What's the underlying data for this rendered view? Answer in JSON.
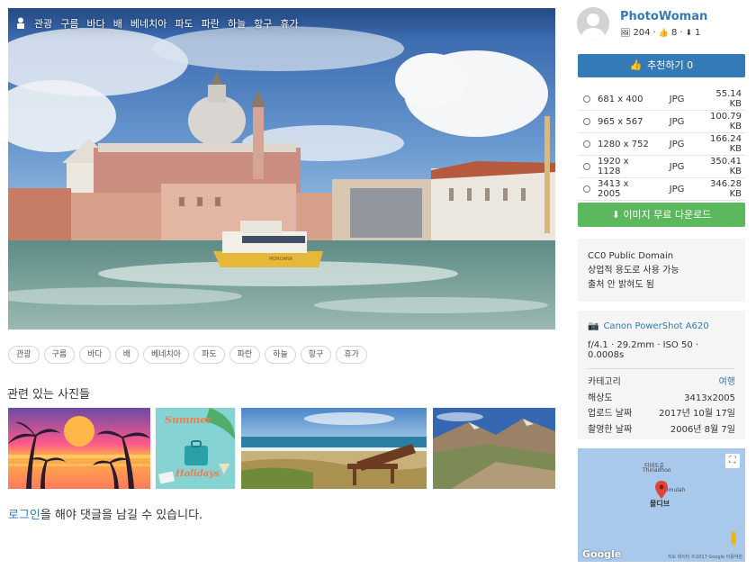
{
  "photo": {
    "tags": [
      "관광",
      "구름",
      "바다",
      "배",
      "베네치아",
      "파도",
      "파란",
      "하늘",
      "항구",
      "휴가"
    ],
    "boat_name": "MOROANA"
  },
  "related": {
    "title": "관련 있는 사진들",
    "thumb2_text": [
      "Summer",
      "Holidays"
    ]
  },
  "comment": {
    "login_link": "로그인",
    "rest": "을 해야 댓글을 남길 수 있습니다."
  },
  "user": {
    "name": "PhotoWoman",
    "images": "204",
    "likes": "8",
    "downloads": "1"
  },
  "recommend_label": "추천하기 0",
  "sizes": [
    {
      "dim": "681 x 400",
      "fmt": "JPG",
      "kb": "55.14 KB"
    },
    {
      "dim": "965 x 567",
      "fmt": "JPG",
      "kb": "100.79 KB"
    },
    {
      "dim": "1280 x 752",
      "fmt": "JPG",
      "kb": "166.24 KB"
    },
    {
      "dim": "1920 x 1128",
      "fmt": "JPG",
      "kb": "350.41 KB"
    },
    {
      "dim": "3413 x 2005",
      "fmt": "JPG",
      "kb": "346.28 KB"
    }
  ],
  "download_label": "이미지 무료 다운로드",
  "license": [
    "CC0 Public Domain",
    "상업적 용도로 사용 가능",
    "출처 안 밝혀도 됨"
  ],
  "meta": {
    "camera": "Canon PowerShot A620",
    "exif": "f/4.1 · 29.2mm · ISO 50 · 0.0008s",
    "rows": [
      {
        "k": "카테고리",
        "v": "여행"
      },
      {
        "k": "해상도",
        "v": "3413x2005"
      },
      {
        "k": "업로드 날짜",
        "v": "2017년 10월 17일"
      },
      {
        "k": "촬영한 날짜",
        "v": "2006년 8월 7일"
      }
    ]
  },
  "map": {
    "place1": "티네도호",
    "place1b": "Thinadhoo",
    "place2": "Fulmulah",
    "pin_label": "몰디브",
    "google": "Google",
    "attribution": "지도 데이터 ©2017 Google   이용약관"
  },
  "colors": {
    "link": "#337ab7",
    "recommend": "#337ab7",
    "download": "#5cb85c"
  }
}
